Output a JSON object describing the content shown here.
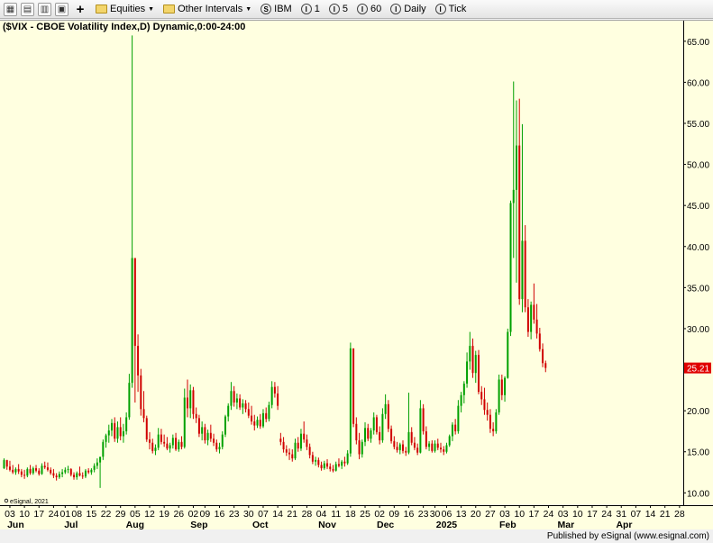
{
  "toolbar": {
    "equities_label": "Equities",
    "intervals_label": "Other Intervals",
    "symbol_label": "IBM",
    "interval_1": "1",
    "interval_5": "5",
    "interval_60": "60",
    "interval_daily": "Daily",
    "interval_tick": "Tick"
  },
  "chart_title": "($VIX - CBOE Volatility Index,D) Dynamic,0:00-24:00",
  "watermark": "eSignal, 2021",
  "footer": "Published by eSignal (www.esignal.com)",
  "colors": {
    "up": "#00a000",
    "down": "#d00000",
    "last_price_bg": "#e00000",
    "background": "#ffffe0"
  },
  "chart_data": {
    "type": "candlestick",
    "title": "($VIX - CBOE Volatility Index,D) Dynamic,0:00-24:00",
    "ylim": [
      8.5,
      67.5
    ],
    "yticks": [
      10,
      15,
      20,
      25,
      30,
      35,
      40,
      45,
      50,
      55,
      60,
      65
    ],
    "ytick_labels": [
      "10.00",
      "15.00",
      "20.00",
      "25.00",
      "30.00",
      "35.00",
      "40.00",
      "45.00",
      "50.00",
      "55.00",
      "60.00",
      "65.00"
    ],
    "last_price": "25.21",
    "last_value": 25.21,
    "xticks": [
      {
        "i": 2,
        "label": "03"
      },
      {
        "i": 7,
        "label": "10"
      },
      {
        "i": 12,
        "label": "17"
      },
      {
        "i": 17,
        "label": "24"
      },
      {
        "i": 21,
        "label": "01"
      },
      {
        "i": 25,
        "label": "08"
      },
      {
        "i": 30,
        "label": "15"
      },
      {
        "i": 35,
        "label": "22"
      },
      {
        "i": 40,
        "label": "29"
      },
      {
        "i": 45,
        "label": "05"
      },
      {
        "i": 50,
        "label": "12"
      },
      {
        "i": 55,
        "label": "19"
      },
      {
        "i": 60,
        "label": "26"
      },
      {
        "i": 65,
        "label": "02"
      },
      {
        "i": 69,
        "label": "09"
      },
      {
        "i": 74,
        "label": "16"
      },
      {
        "i": 79,
        "label": "23"
      },
      {
        "i": 84,
        "label": "30"
      },
      {
        "i": 89,
        "label": "07"
      },
      {
        "i": 94,
        "label": "14"
      },
      {
        "i": 99,
        "label": "21"
      },
      {
        "i": 104,
        "label": "28"
      },
      {
        "i": 109,
        "label": "04"
      },
      {
        "i": 114,
        "label": "11"
      },
      {
        "i": 119,
        "label": "18"
      },
      {
        "i": 124,
        "label": "25"
      },
      {
        "i": 129,
        "label": "02"
      },
      {
        "i": 134,
        "label": "09"
      },
      {
        "i": 139,
        "label": "16"
      },
      {
        "i": 144,
        "label": "23"
      },
      {
        "i": 148,
        "label": "30"
      },
      {
        "i": 152,
        "label": "06"
      },
      {
        "i": 157,
        "label": "13"
      },
      {
        "i": 162,
        "label": "20"
      },
      {
        "i": 167,
        "label": "27"
      },
      {
        "i": 172,
        "label": "03"
      },
      {
        "i": 177,
        "label": "10"
      },
      {
        "i": 182,
        "label": "17"
      },
      {
        "i": 187,
        "label": "24"
      },
      {
        "i": 192,
        "label": "03"
      },
      {
        "i": 197,
        "label": "10"
      },
      {
        "i": 202,
        "label": "17"
      },
      {
        "i": 207,
        "label": "24"
      },
      {
        "i": 212,
        "label": "31"
      },
      {
        "i": 217,
        "label": "07"
      },
      {
        "i": 222,
        "label": "14"
      },
      {
        "i": 227,
        "label": "21"
      },
      {
        "i": 232,
        "label": "28"
      }
    ],
    "months": [
      {
        "i": 4,
        "label": "Jun"
      },
      {
        "i": 23,
        "label": "Jul"
      },
      {
        "i": 45,
        "label": "Aug"
      },
      {
        "i": 67,
        "label": "Sep"
      },
      {
        "i": 88,
        "label": "Oct"
      },
      {
        "i": 111,
        "label": "Nov"
      },
      {
        "i": 131,
        "label": "Dec"
      },
      {
        "i": 152,
        "label": "2025"
      },
      {
        "i": 173,
        "label": "Feb"
      },
      {
        "i": 193,
        "label": "Mar"
      },
      {
        "i": 213,
        "label": "Apr"
      }
    ],
    "ohlc_start_index": 0,
    "ohlc": [
      [
        13.0,
        14.2,
        12.9,
        14.0
      ],
      [
        14.0,
        14.0,
        12.8,
        13.2
      ],
      [
        13.2,
        13.9,
        12.6,
        12.8
      ],
      [
        12.8,
        13.4,
        12.3,
        12.5
      ],
      [
        12.5,
        13.1,
        12.2,
        12.9
      ],
      [
        12.9,
        13.5,
        12.3,
        12.6
      ],
      [
        12.6,
        12.9,
        11.9,
        12.2
      ],
      [
        12.2,
        12.8,
        11.7,
        12.1
      ],
      [
        12.1,
        13.1,
        11.9,
        12.9
      ],
      [
        12.9,
        13.4,
        12.2,
        12.4
      ],
      [
        12.4,
        13.2,
        12.2,
        13.0
      ],
      [
        13.0,
        13.4,
        12.5,
        12.7
      ],
      [
        12.7,
        13.0,
        12.1,
        12.3
      ],
      [
        12.3,
        13.6,
        12.2,
        13.3
      ],
      [
        13.3,
        13.8,
        12.9,
        13.1
      ],
      [
        13.1,
        13.7,
        12.6,
        12.8
      ],
      [
        12.8,
        13.1,
        12.2,
        12.4
      ],
      [
        12.4,
        12.9,
        11.8,
        12.1
      ],
      [
        12.1,
        12.4,
        11.5,
        11.9
      ],
      [
        11.9,
        12.6,
        11.7,
        12.3
      ],
      [
        12.3,
        12.9,
        11.9,
        12.5
      ],
      [
        12.5,
        13.1,
        12.3,
        12.8
      ],
      [
        12.8,
        13.3,
        12.4,
        12.9
      ],
      [
        12.9,
        13.0,
        12.0,
        12.2
      ],
      [
        12.2,
        12.5,
        11.6,
        11.9
      ],
      [
        11.9,
        12.6,
        11.6,
        12.4
      ],
      [
        12.4,
        13.2,
        12.0,
        12.1
      ],
      [
        12.1,
        12.5,
        11.7,
        12.0
      ],
      [
        12.0,
        12.9,
        11.8,
        12.7
      ],
      [
        12.7,
        13.0,
        12.3,
        12.5
      ],
      [
        12.5,
        13.0,
        12.2,
        12.8
      ],
      [
        12.8,
        13.6,
        12.5,
        13.3
      ],
      [
        13.3,
        14.2,
        12.9,
        13.7
      ],
      [
        13.7,
        14.0,
        10.6,
        14.4
      ],
      [
        14.4,
        16.5,
        14.0,
        16.2
      ],
      [
        16.2,
        17.2,
        15.5,
        17.0
      ],
      [
        17.0,
        18.3,
        16.1,
        17.6
      ],
      [
        17.6,
        19.0,
        16.9,
        18.5
      ],
      [
        18.5,
        19.2,
        16.2,
        16.6
      ],
      [
        16.6,
        18.7,
        16.1,
        18.0
      ],
      [
        18.0,
        19.2,
        16.4,
        16.9
      ],
      [
        16.9,
        18.4,
        16.1,
        17.5
      ],
      [
        17.5,
        19.8,
        17.1,
        19.2
      ],
      [
        19.2,
        24.5,
        18.9,
        23.4
      ],
      [
        23.4,
        65.7,
        22.8,
        38.6
      ],
      [
        38.6,
        32.0,
        21.0,
        27.9
      ],
      [
        27.9,
        29.3,
        22.3,
        24.3
      ],
      [
        24.3,
        25.1,
        19.4,
        20.2
      ],
      [
        20.2,
        22.4,
        18.6,
        19.1
      ],
      [
        19.1,
        19.4,
        16.2,
        16.5
      ],
      [
        16.5,
        17.4,
        15.3,
        16.1
      ],
      [
        16.1,
        16.6,
        14.8,
        15.1
      ],
      [
        15.1,
        15.9,
        14.6,
        15.5
      ],
      [
        15.5,
        17.9,
        15.2,
        17.1
      ],
      [
        17.1,
        17.8,
        15.9,
        16.2
      ],
      [
        16.2,
        17.1,
        15.6,
        16.0
      ],
      [
        16.0,
        16.8,
        15.2,
        15.4
      ],
      [
        15.4,
        16.1,
        14.9,
        15.8
      ],
      [
        15.8,
        17.1,
        15.4,
        16.7
      ],
      [
        16.7,
        17.3,
        15.1,
        15.3
      ],
      [
        15.3,
        16.5,
        15.0,
        16.2
      ],
      [
        16.2,
        16.9,
        15.3,
        15.6
      ],
      [
        15.6,
        22.7,
        15.4,
        21.6
      ],
      [
        21.6,
        23.8,
        19.2,
        20.3
      ],
      [
        20.3,
        23.2,
        19.1,
        22.5
      ],
      [
        22.5,
        22.9,
        19.0,
        19.6
      ],
      [
        19.6,
        20.4,
        18.5,
        19.1
      ],
      [
        19.1,
        19.5,
        16.8,
        17.2
      ],
      [
        17.2,
        18.7,
        16.4,
        18.0
      ],
      [
        18.0,
        18.4,
        16.0,
        16.4
      ],
      [
        16.4,
        17.7,
        15.8,
        17.3
      ],
      [
        17.3,
        18.3,
        16.2,
        16.6
      ],
      [
        16.6,
        17.2,
        15.7,
        16.1
      ],
      [
        16.1,
        16.5,
        15.0,
        15.3
      ],
      [
        15.3,
        16.1,
        14.8,
        15.6
      ],
      [
        15.6,
        17.5,
        15.3,
        17.1
      ],
      [
        17.1,
        19.5,
        16.8,
        19.3
      ],
      [
        19.3,
        20.9,
        18.7,
        20.6
      ],
      [
        20.6,
        23.5,
        20.1,
        22.4
      ],
      [
        22.4,
        23.0,
        20.5,
        21.0
      ],
      [
        21.0,
        22.1,
        20.2,
        21.5
      ],
      [
        21.5,
        22.0,
        20.1,
        20.4
      ],
      [
        20.4,
        21.4,
        19.6,
        20.9
      ],
      [
        20.9,
        21.3,
        19.8,
        20.2
      ],
      [
        20.2,
        21.0,
        19.1,
        19.4
      ],
      [
        19.4,
        20.6,
        18.3,
        18.7
      ],
      [
        18.7,
        19.5,
        17.6,
        18.2
      ],
      [
        18.2,
        19.3,
        17.9,
        18.9
      ],
      [
        18.9,
        19.6,
        17.8,
        18.1
      ],
      [
        18.1,
        20.2,
        17.9,
        19.7
      ],
      [
        19.7,
        20.4,
        18.6,
        19.0
      ],
      [
        19.0,
        21.1,
        18.7,
        20.7
      ],
      [
        20.7,
        23.6,
        20.3,
        22.9
      ],
      [
        22.9,
        23.5,
        21.6,
        22.1
      ],
      [
        22.1,
        23.0,
        20.1,
        20.6
      ],
      [
        16.6,
        17.3,
        15.8,
        16.2
      ],
      [
        16.2,
        16.8,
        14.9,
        15.3
      ],
      [
        15.3,
        15.8,
        14.5,
        14.9
      ],
      [
        14.9,
        15.4,
        14.0,
        14.7
      ],
      [
        14.7,
        15.3,
        13.8,
        14.2
      ],
      [
        14.2,
        16.6,
        14.0,
        16.1
      ],
      [
        16.1,
        16.8,
        15.0,
        15.4
      ],
      [
        15.4,
        17.8,
        15.1,
        17.2
      ],
      [
        17.2,
        18.7,
        16.1,
        16.5
      ],
      [
        16.5,
        17.1,
        15.2,
        15.6
      ],
      [
        15.6,
        16.0,
        14.2,
        14.6
      ],
      [
        14.6,
        15.0,
        13.5,
        13.8
      ],
      [
        13.8,
        14.4,
        13.3,
        14.0
      ],
      [
        14.0,
        14.3,
        13.1,
        13.4
      ],
      [
        13.4,
        13.8,
        12.7,
        13.0
      ],
      [
        13.0,
        13.9,
        12.8,
        13.6
      ],
      [
        13.6,
        14.1,
        12.9,
        13.2
      ],
      [
        13.2,
        13.6,
        12.6,
        12.9
      ],
      [
        12.9,
        13.4,
        12.5,
        12.7
      ],
      [
        12.7,
        13.8,
        12.6,
        13.5
      ],
      [
        13.5,
        14.2,
        13.1,
        13.3
      ],
      [
        13.3,
        14.0,
        12.9,
        13.8
      ],
      [
        13.8,
        14.4,
        13.2,
        13.6
      ],
      [
        13.6,
        15.2,
        13.4,
        14.8
      ],
      [
        14.8,
        28.3,
        14.4,
        27.6
      ],
      [
        27.6,
        27.0,
        18.0,
        18.4
      ],
      [
        18.4,
        19.2,
        15.9,
        16.4
      ],
      [
        16.4,
        17.3,
        14.1,
        14.7
      ],
      [
        14.7,
        16.5,
        14.3,
        16.2
      ],
      [
        16.2,
        18.6,
        15.7,
        17.9
      ],
      [
        17.9,
        18.4,
        16.3,
        16.6
      ],
      [
        16.6,
        17.9,
        16.1,
        17.6
      ],
      [
        17.6,
        19.8,
        17.1,
        19.2
      ],
      [
        19.2,
        19.5,
        17.1,
        17.4
      ],
      [
        17.4,
        18.1,
        15.9,
        16.4
      ],
      [
        16.4,
        20.3,
        16.1,
        19.6
      ],
      [
        19.6,
        22.0,
        19.0,
        20.8
      ],
      [
        20.8,
        21.3,
        17.4,
        17.8
      ],
      [
        17.8,
        18.2,
        16.0,
        16.3
      ],
      [
        16.3,
        16.9,
        15.3,
        15.6
      ],
      [
        15.6,
        16.2,
        14.9,
        15.2
      ],
      [
        15.2,
        16.1,
        14.7,
        15.9
      ],
      [
        15.9,
        16.4,
        14.8,
        15.1
      ],
      [
        15.1,
        15.6,
        14.5,
        14.9
      ],
      [
        14.9,
        22.2,
        14.7,
        17.4
      ],
      [
        17.4,
        18.0,
        15.8,
        16.1
      ],
      [
        16.1,
        16.8,
        15.2,
        15.5
      ],
      [
        15.5,
        16.0,
        14.6,
        14.9
      ],
      [
        14.9,
        21.3,
        14.8,
        20.3
      ],
      [
        20.3,
        20.8,
        17.1,
        17.5
      ],
      [
        17.5,
        18.1,
        15.3,
        15.6
      ],
      [
        15.6,
        16.3,
        15.1,
        16.0
      ],
      [
        16.0,
        16.4,
        14.9,
        15.1
      ],
      [
        15.1,
        16.4,
        14.9,
        16.0
      ],
      [
        16.0,
        16.6,
        15.2,
        15.5
      ],
      [
        15.5,
        16.1,
        14.9,
        15.3
      ],
      [
        15.3,
        15.7,
        14.6,
        15.0
      ],
      [
        15.0,
        16.1,
        14.8,
        15.8
      ],
      [
        15.8,
        17.1,
        15.6,
        16.9
      ],
      [
        16.9,
        18.6,
        16.3,
        18.3
      ],
      [
        18.3,
        19.0,
        17.1,
        17.5
      ],
      [
        17.5,
        21.3,
        17.2,
        20.6
      ],
      [
        20.6,
        22.3,
        19.8,
        21.9
      ],
      [
        21.9,
        23.6,
        20.9,
        23.3
      ],
      [
        23.3,
        27.1,
        22.8,
        26.0
      ],
      [
        26.0,
        29.6,
        25.0,
        27.9
      ],
      [
        27.9,
        28.8,
        24.0,
        24.6
      ],
      [
        24.6,
        27.3,
        23.4,
        26.8
      ],
      [
        26.8,
        27.4,
        22.0,
        22.3
      ],
      [
        22.3,
        23.0,
        20.7,
        21.4
      ],
      [
        21.4,
        22.8,
        19.5,
        20.1
      ],
      [
        20.1,
        21.0,
        18.8,
        19.5
      ],
      [
        19.5,
        20.2,
        17.3,
        17.8
      ],
      [
        17.8,
        18.6,
        16.9,
        17.5
      ],
      [
        17.5,
        20.2,
        17.2,
        19.8
      ],
      [
        19.8,
        24.4,
        19.5,
        23.8
      ],
      [
        23.8,
        24.4,
        21.3,
        21.9
      ],
      [
        21.9,
        24.2,
        21.1,
        24.0
      ],
      [
        24.0,
        30.0,
        23.9,
        29.6
      ],
      [
        29.6,
        45.6,
        29.1,
        45.3
      ],
      [
        45.3,
        60.1,
        38.6,
        46.9
      ],
      [
        46.9,
        57.8,
        35.6,
        52.3
      ],
      [
        52.3,
        58.0,
        32.9,
        33.6
      ],
      [
        33.6,
        54.9,
        32.0,
        40.7
      ],
      [
        40.7,
        42.6,
        32.0,
        32.6
      ],
      [
        32.6,
        33.6,
        29.0,
        29.6
      ],
      [
        29.6,
        33.3,
        28.7,
        32.9
      ],
      [
        32.9,
        35.5,
        30.6,
        31.1
      ],
      [
        31.1,
        33.0,
        28.8,
        29.4
      ],
      [
        29.4,
        30.1,
        27.2,
        27.5
      ],
      [
        27.5,
        28.2,
        25.3,
        25.8
      ],
      [
        25.8,
        26.1,
        24.7,
        25.21
      ]
    ]
  }
}
